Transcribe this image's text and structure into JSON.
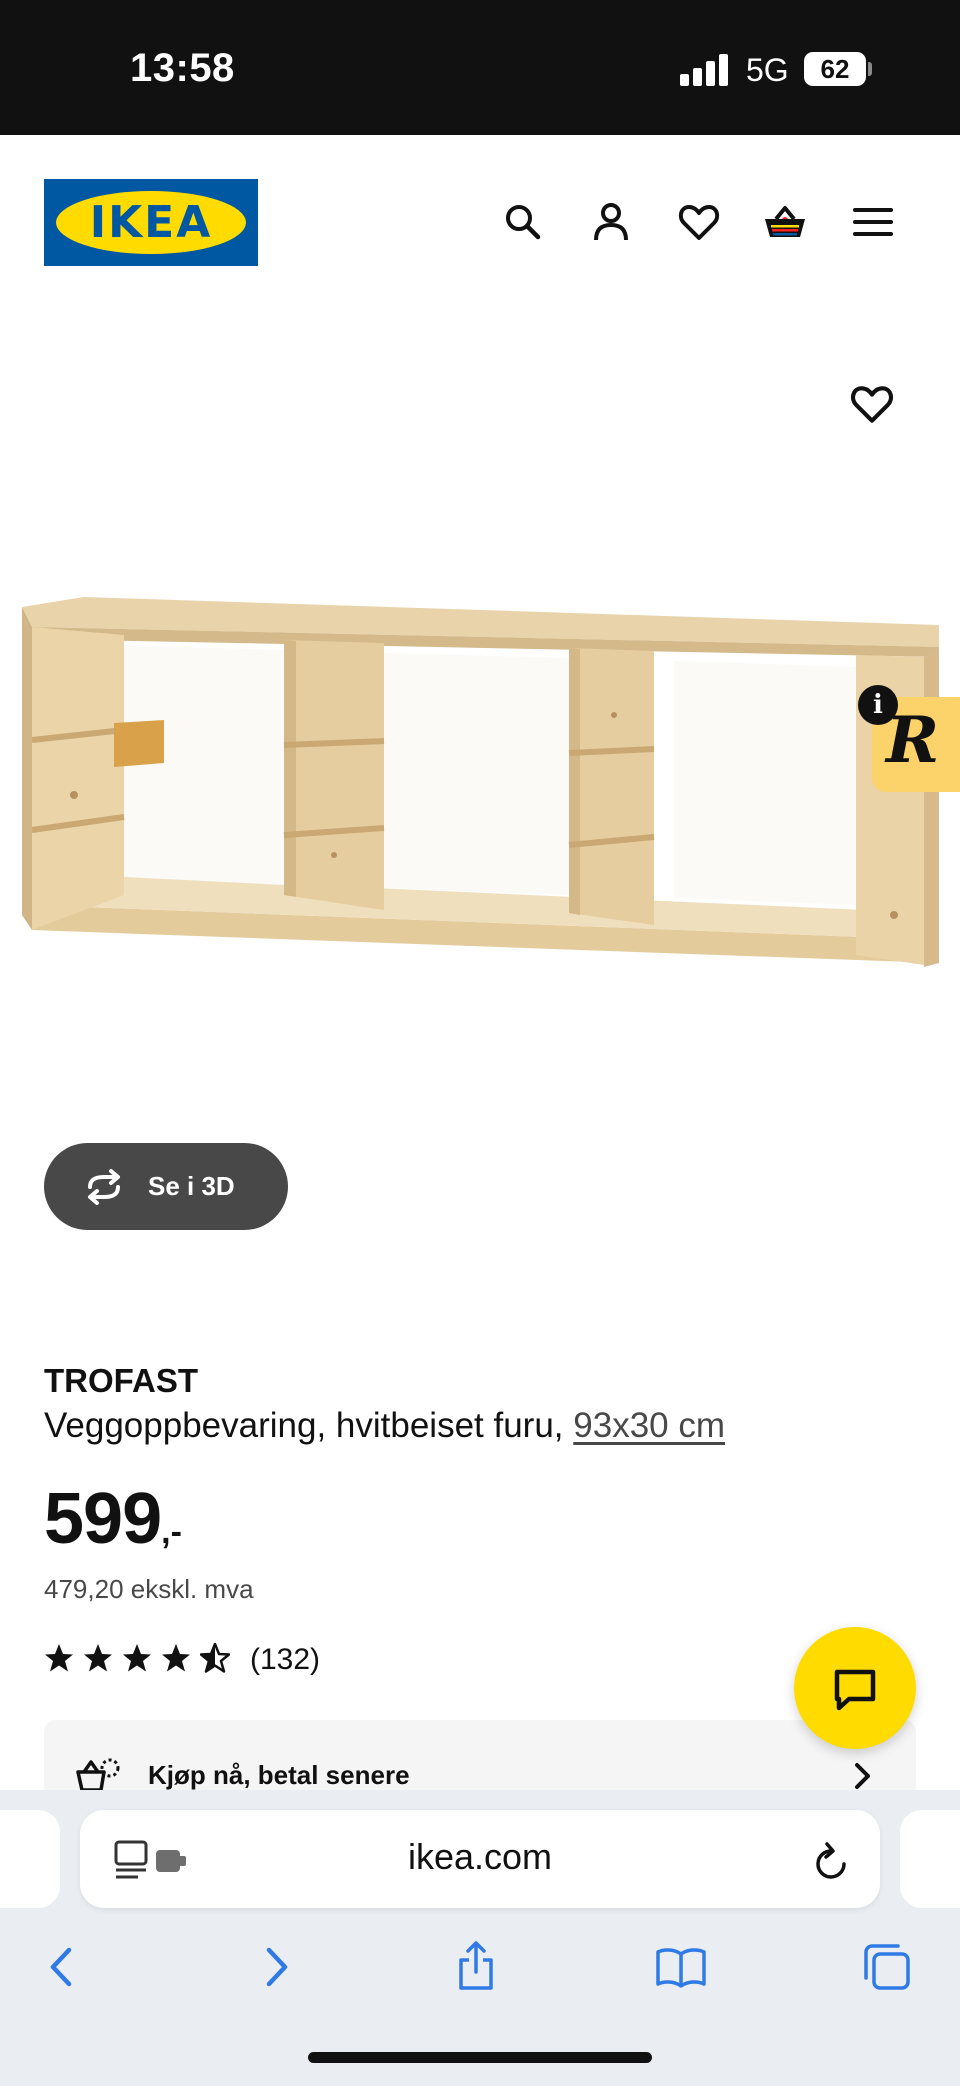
{
  "status_bar": {
    "time": "13:58",
    "network": "5G",
    "battery": "62"
  },
  "header": {
    "logo_text": "IKEA",
    "logo_mark": "®",
    "icons": [
      "search-icon",
      "account-icon",
      "wishlist-icon",
      "cart-icon",
      "menu-icon"
    ]
  },
  "product": {
    "view_3d_label": "Se i 3D",
    "name": "TROFAST",
    "description": "Veggoppbevaring, hvitbeiset furu,",
    "size": "93x30 cm",
    "price_integer": "599",
    "price_suffix": ",-",
    "price_ex_vat": "479,20 ekskl. mva",
    "rating": 4.5,
    "rating_max": 5,
    "review_count": "(132)",
    "bnpl_label": "Kjøp nå, betal senere"
  },
  "extension": {
    "badge_letter": "R",
    "info_glyph": "i"
  },
  "browser": {
    "url": "ikea.com",
    "toolbar_icons": [
      "back-icon",
      "forward-icon",
      "share-icon",
      "bookmarks-icon",
      "tabs-icon"
    ]
  },
  "colors": {
    "ikea_blue": "#0058a3",
    "ikea_yellow": "#ffdb00",
    "button_dark": "#484848",
    "safari_blue": "#2f7ae5"
  }
}
